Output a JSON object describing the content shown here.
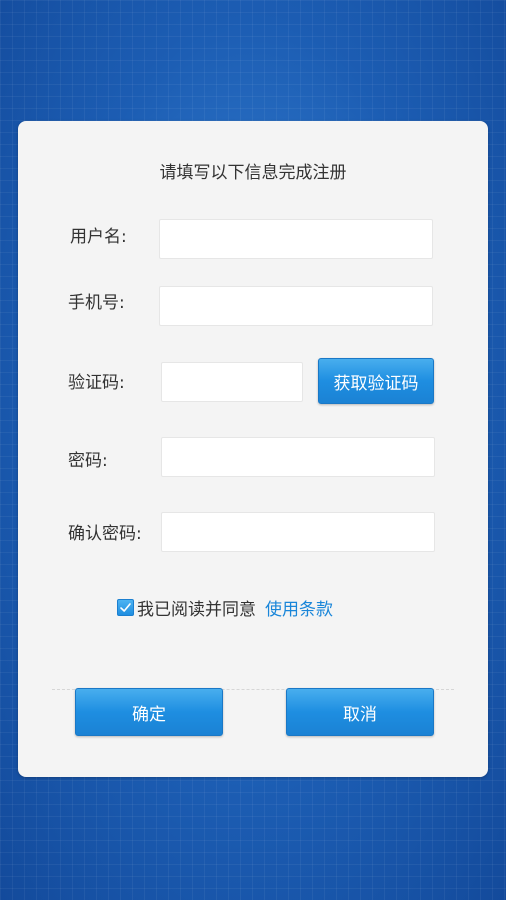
{
  "form": {
    "heading": "请填写以下信息完成注册",
    "username_label": "用户名:",
    "username_value": "",
    "phone_label": "手机号:",
    "phone_value": "",
    "code_label": "验证码:",
    "code_value": "",
    "get_code_button": "获取验证码",
    "password_label": "密码:",
    "password_value": "",
    "confirm_password_label": "确认密码:",
    "confirm_password_value": ""
  },
  "agreement": {
    "checked": true,
    "text": "我已阅读并同意",
    "terms_link": "使用条款"
  },
  "actions": {
    "confirm_label": "确定",
    "cancel_label": "取消"
  },
  "colors": {
    "background": "#1f63b8",
    "card": "#f4f4f4",
    "accent": "#1e8ee1",
    "link": "#1a86d9"
  }
}
